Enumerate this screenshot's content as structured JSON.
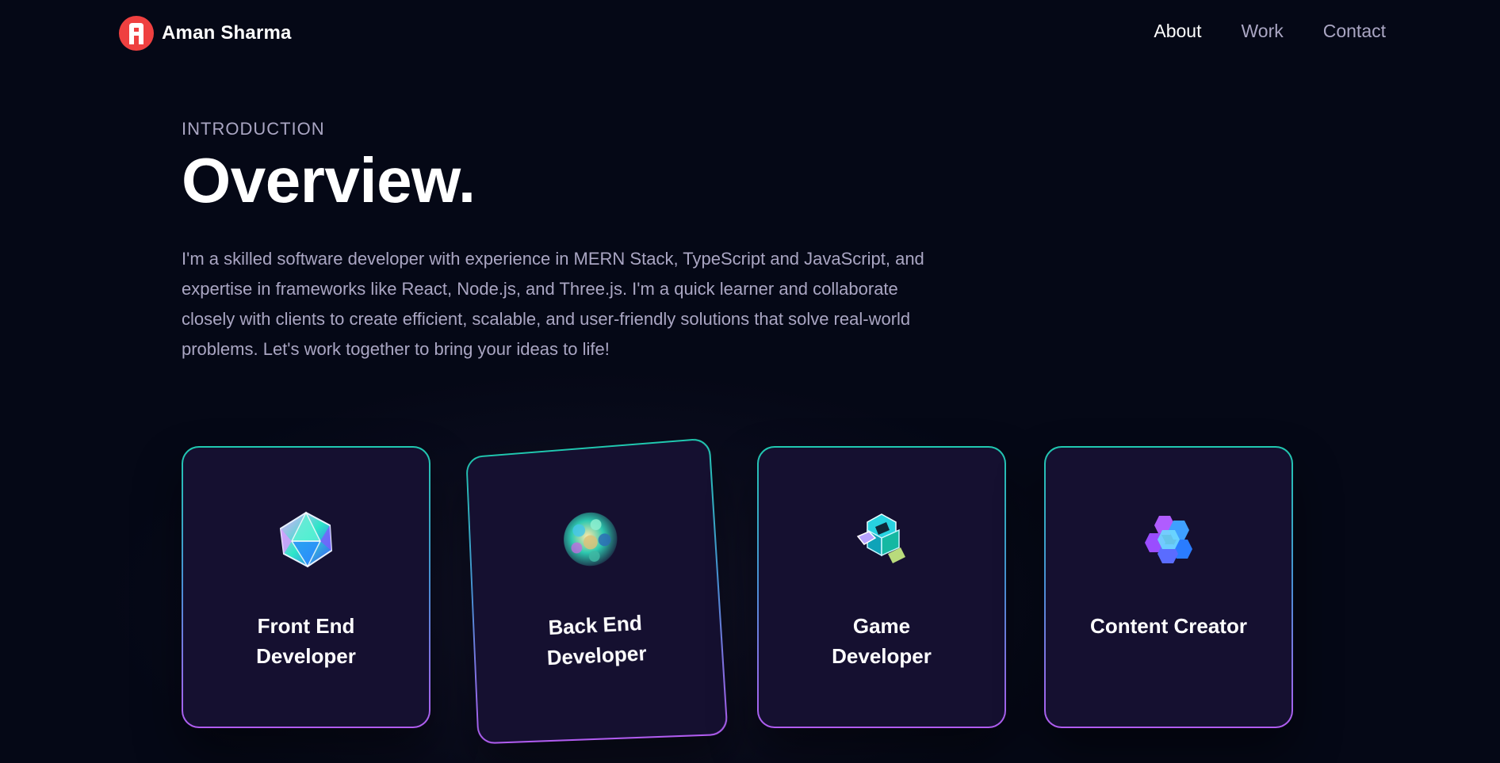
{
  "brand": {
    "name": "Aman Sharma",
    "logo_icon": "logo-a-icon",
    "logo_color": "#ef4040"
  },
  "nav": {
    "links": [
      {
        "label": "About",
        "active": true
      },
      {
        "label": "Work",
        "active": false
      },
      {
        "label": "Contact",
        "active": false
      }
    ]
  },
  "overview": {
    "eyebrow": "INTRODUCTION",
    "title": "Overview.",
    "description": "I'm a skilled software developer with experience in MERN Stack, TypeScript and JavaScript, and expertise in frameworks like React, Node.js, and Three.js. I'm a quick learner and collaborate closely with clients to create efficient, scalable, and user-friendly solutions that solve real-world problems. Let's work together to bring your ideas to life!"
  },
  "services": [
    {
      "title": "Front End Developer",
      "icon": "icosahedron-icon"
    },
    {
      "title": "Back End Developer",
      "icon": "sphere-cluster-icon"
    },
    {
      "title": "Game Developer",
      "icon": "cube-cluster-icon"
    },
    {
      "title": "Content Creator",
      "icon": "hexagon-cluster-icon"
    }
  ],
  "colors": {
    "background": "#050816",
    "card": "#151030",
    "secondary_text": "#aaa6c3",
    "border_top": "#20c9b0",
    "border_bottom": "#b15cf0"
  }
}
